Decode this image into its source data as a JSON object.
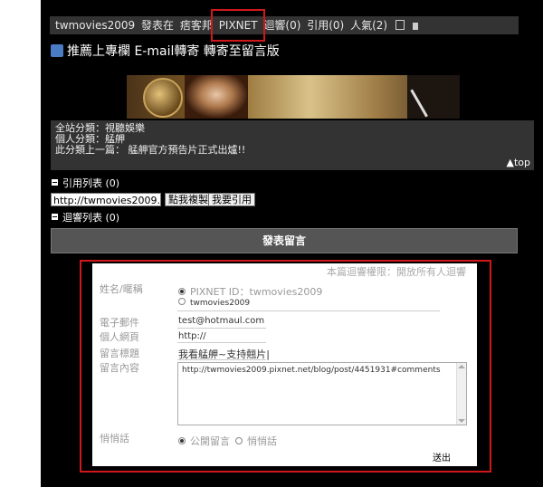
{
  "post_meta": {
    "author": "twmovies2009",
    "posted_in": "發表在",
    "site": "痞客邦",
    "platform": "PIXNET",
    "replies_link": "迴響(0)",
    "trackback_link": "引用(0)",
    "popularity": "人氣(2)",
    "edit_icon": "edit-icon",
    "delete_icon": "trash-icon"
  },
  "share_line": {
    "icon": "thumbs-up-icon",
    "text": "推薦上專欄 E-mail轉寄 轉寄至留言版"
  },
  "categories": {
    "site_category": "全站分類：視聽娛樂",
    "personal_category": "個人分類：艋舺",
    "prev_post": "此分類上一篇： 艋舺官方預告片正式出爐!!",
    "top_link": "▲top"
  },
  "trackback": {
    "header": "引用列表 (0)",
    "url_value": "http://twmovies2009.pixne",
    "copy_button": "點我複製",
    "trackback_button": "我要引用"
  },
  "replies_header": "迴響列表 (0)",
  "post_comment_button": "發表留言",
  "comment_form": {
    "permission_note": "本篇迴響權限：開放所有人迴響",
    "name_label": "姓名/暱稱",
    "pixnet_id_option": "PIXNET ID：twmovies2009",
    "name_option": "twmovies2009",
    "email_label": "電子郵件",
    "email_value": "test@hotmaul.com",
    "website_label": "個人網頁",
    "website_value": "http://",
    "title_label": "留言標題",
    "title_value": "我看艋舺~支持翹片|",
    "content_label": "留言內容",
    "content_value": "http://twmovies2009.pixnet.net/blog/post/4451931#comments",
    "whisper_label": "悄悄話",
    "public_option": "公開留言",
    "whisper_option": "悄悄話",
    "submit_label": "送出"
  }
}
